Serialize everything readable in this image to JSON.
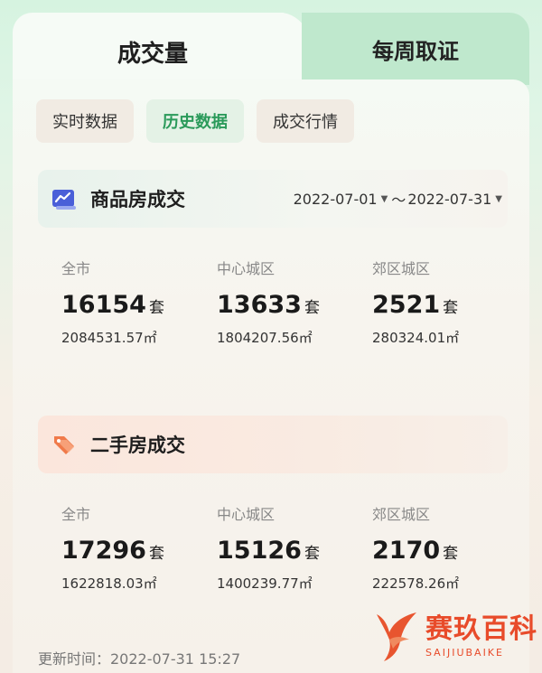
{
  "tabs": {
    "volume_label": "成交量",
    "weekly_label": "每周取证"
  },
  "subtabs": [
    {
      "label": "实时数据",
      "active": false
    },
    {
      "label": "历史数据",
      "active": true
    },
    {
      "label": "成交行情",
      "active": false
    }
  ],
  "new_homes": {
    "title": "商品房成交",
    "date_start": "2022-07-01",
    "date_sep": "～",
    "date_end": "2022-07-31",
    "unit": "套",
    "stats": [
      {
        "label": "全市",
        "count": "16154",
        "area": "2084531.57㎡"
      },
      {
        "label": "中心城区",
        "count": "13633",
        "area": "1804207.56㎡"
      },
      {
        "label": "郊区城区",
        "count": "2521",
        "area": "280324.01㎡"
      }
    ]
  },
  "resale": {
    "title": "二手房成交",
    "unit": "套",
    "stats": [
      {
        "label": "全市",
        "count": "17296",
        "area": "1622818.03㎡"
      },
      {
        "label": "中心城区",
        "count": "15126",
        "area": "1400239.77㎡"
      },
      {
        "label": "郊区城区",
        "count": "2170",
        "area": "222578.26㎡"
      }
    ]
  },
  "updated": "更新时间：2022-07-31 15:27",
  "brand": {
    "name_cn": "赛玖百科",
    "name_en": "SAIJIUBAIKE"
  },
  "colors": {
    "accent_green": "#2a9a5a",
    "brand_red": "#e84b2a"
  },
  "icons": {
    "new_homes": "chart-icon",
    "resale": "tag-icon",
    "dropdown": "caret-down-icon"
  }
}
